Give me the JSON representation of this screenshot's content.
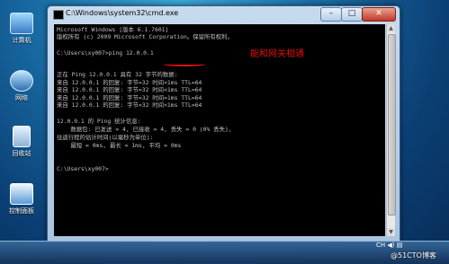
{
  "desktop": {
    "icons": [
      {
        "label": "计算机",
        "icon": "computer-icon"
      },
      {
        "label": "网络",
        "icon": "network-icon"
      },
      {
        "label": "回收站",
        "icon": "recycle-bin-icon"
      },
      {
        "label": "控制面板",
        "icon": "control-panel-icon"
      }
    ]
  },
  "window": {
    "title": "C:\\Windows\\system32\\cmd.exe",
    "minimize": "–",
    "maximize": "□",
    "close": "✕"
  },
  "console": {
    "lines": [
      "Microsoft Windows [版本 6.1.7601]",
      "版权所有 (c) 2009 Microsoft Corporation。保留所有权利。",
      "",
      "C:\\Users\\xy007>ping 12.0.0.1",
      "",
      "正在 Ping 12.0.0.1 具有 32 字节的数据:",
      "来自 12.0.0.1 的回复: 字节=32 时间<1ms TTL=64",
      "来自 12.0.0.1 的回复: 字节=32 时间<1ms TTL=64",
      "来自 12.0.0.1 的回复: 字节=32 时间=1ms TTL=64",
      "来自 12.0.0.1 的回复: 字节=32 时间<1ms TTL=64",
      "",
      "12.0.0.1 的 Ping 统计信息:",
      "    数据包: 已发送 = 4, 已接收 = 4, 丢失 = 0 (0% 丢失),",
      "往返行程的估计时间(以毫秒为单位):",
      "    最短 = 0ms, 最长 = 1ms, 平均 = 0ms",
      "",
      "C:\\Users\\xy007>"
    ]
  },
  "annotation": {
    "text": "能和网关相通",
    "color": "#e01010"
  },
  "taskbar": {
    "tray_label": "CH",
    "watermark": "@51CTO博客"
  }
}
